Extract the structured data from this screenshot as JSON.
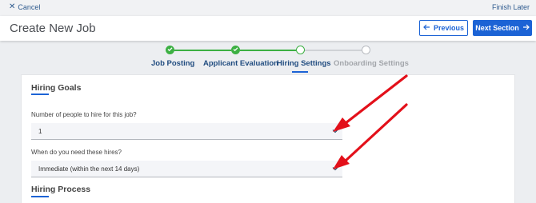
{
  "topbar": {
    "cancel_label": "Cancel",
    "finish_label": "Finish Later"
  },
  "header": {
    "title": "Create New Job",
    "previous_label": "Previous",
    "next_label": "Next Section"
  },
  "stepper": {
    "steps": [
      {
        "label": "Job Posting",
        "state": "complete"
      },
      {
        "label": "Applicant Evaluation",
        "state": "complete"
      },
      {
        "label": "Hiring Settings",
        "state": "current"
      },
      {
        "label": "Onboarding Settings",
        "state": "upcoming"
      }
    ]
  },
  "form": {
    "hiring_goals_title": "Hiring Goals",
    "people_label": "Number of people to hire for this job?",
    "people_value": "1",
    "when_label": "When do you need these hires?",
    "when_value": "Immediate (within the next 14 days)",
    "hiring_process_title": "Hiring Process"
  },
  "colors": {
    "accent": "#1c63d5",
    "complete": "#3cb043",
    "annotation": "#e3101a"
  }
}
